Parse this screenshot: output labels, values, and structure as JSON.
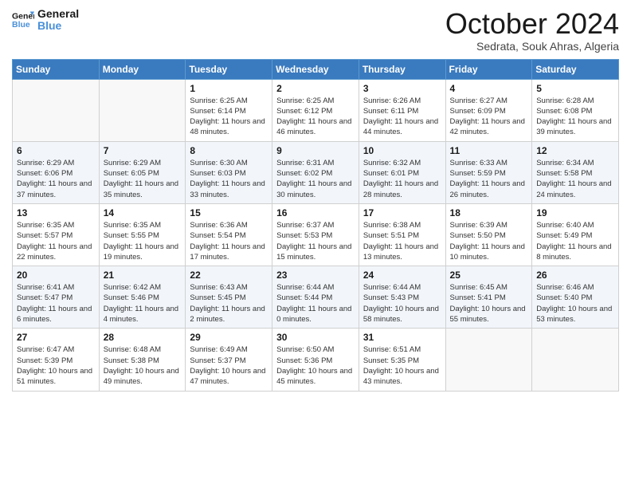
{
  "header": {
    "logo_line1": "General",
    "logo_line2": "Blue",
    "month": "October 2024",
    "location": "Sedrata, Souk Ahras, Algeria"
  },
  "weekdays": [
    "Sunday",
    "Monday",
    "Tuesday",
    "Wednesday",
    "Thursday",
    "Friday",
    "Saturday"
  ],
  "weeks": [
    [
      {
        "day": "",
        "sunrise": "",
        "sunset": "",
        "daylight": ""
      },
      {
        "day": "",
        "sunrise": "",
        "sunset": "",
        "daylight": ""
      },
      {
        "day": "1",
        "sunrise": "Sunrise: 6:25 AM",
        "sunset": "Sunset: 6:14 PM",
        "daylight": "Daylight: 11 hours and 48 minutes."
      },
      {
        "day": "2",
        "sunrise": "Sunrise: 6:25 AM",
        "sunset": "Sunset: 6:12 PM",
        "daylight": "Daylight: 11 hours and 46 minutes."
      },
      {
        "day": "3",
        "sunrise": "Sunrise: 6:26 AM",
        "sunset": "Sunset: 6:11 PM",
        "daylight": "Daylight: 11 hours and 44 minutes."
      },
      {
        "day": "4",
        "sunrise": "Sunrise: 6:27 AM",
        "sunset": "Sunset: 6:09 PM",
        "daylight": "Daylight: 11 hours and 42 minutes."
      },
      {
        "day": "5",
        "sunrise": "Sunrise: 6:28 AM",
        "sunset": "Sunset: 6:08 PM",
        "daylight": "Daylight: 11 hours and 39 minutes."
      }
    ],
    [
      {
        "day": "6",
        "sunrise": "Sunrise: 6:29 AM",
        "sunset": "Sunset: 6:06 PM",
        "daylight": "Daylight: 11 hours and 37 minutes."
      },
      {
        "day": "7",
        "sunrise": "Sunrise: 6:29 AM",
        "sunset": "Sunset: 6:05 PM",
        "daylight": "Daylight: 11 hours and 35 minutes."
      },
      {
        "day": "8",
        "sunrise": "Sunrise: 6:30 AM",
        "sunset": "Sunset: 6:03 PM",
        "daylight": "Daylight: 11 hours and 33 minutes."
      },
      {
        "day": "9",
        "sunrise": "Sunrise: 6:31 AM",
        "sunset": "Sunset: 6:02 PM",
        "daylight": "Daylight: 11 hours and 30 minutes."
      },
      {
        "day": "10",
        "sunrise": "Sunrise: 6:32 AM",
        "sunset": "Sunset: 6:01 PM",
        "daylight": "Daylight: 11 hours and 28 minutes."
      },
      {
        "day": "11",
        "sunrise": "Sunrise: 6:33 AM",
        "sunset": "Sunset: 5:59 PM",
        "daylight": "Daylight: 11 hours and 26 minutes."
      },
      {
        "day": "12",
        "sunrise": "Sunrise: 6:34 AM",
        "sunset": "Sunset: 5:58 PM",
        "daylight": "Daylight: 11 hours and 24 minutes."
      }
    ],
    [
      {
        "day": "13",
        "sunrise": "Sunrise: 6:35 AM",
        "sunset": "Sunset: 5:57 PM",
        "daylight": "Daylight: 11 hours and 22 minutes."
      },
      {
        "day": "14",
        "sunrise": "Sunrise: 6:35 AM",
        "sunset": "Sunset: 5:55 PM",
        "daylight": "Daylight: 11 hours and 19 minutes."
      },
      {
        "day": "15",
        "sunrise": "Sunrise: 6:36 AM",
        "sunset": "Sunset: 5:54 PM",
        "daylight": "Daylight: 11 hours and 17 minutes."
      },
      {
        "day": "16",
        "sunrise": "Sunrise: 6:37 AM",
        "sunset": "Sunset: 5:53 PM",
        "daylight": "Daylight: 11 hours and 15 minutes."
      },
      {
        "day": "17",
        "sunrise": "Sunrise: 6:38 AM",
        "sunset": "Sunset: 5:51 PM",
        "daylight": "Daylight: 11 hours and 13 minutes."
      },
      {
        "day": "18",
        "sunrise": "Sunrise: 6:39 AM",
        "sunset": "Sunset: 5:50 PM",
        "daylight": "Daylight: 11 hours and 10 minutes."
      },
      {
        "day": "19",
        "sunrise": "Sunrise: 6:40 AM",
        "sunset": "Sunset: 5:49 PM",
        "daylight": "Daylight: 11 hours and 8 minutes."
      }
    ],
    [
      {
        "day": "20",
        "sunrise": "Sunrise: 6:41 AM",
        "sunset": "Sunset: 5:47 PM",
        "daylight": "Daylight: 11 hours and 6 minutes."
      },
      {
        "day": "21",
        "sunrise": "Sunrise: 6:42 AM",
        "sunset": "Sunset: 5:46 PM",
        "daylight": "Daylight: 11 hours and 4 minutes."
      },
      {
        "day": "22",
        "sunrise": "Sunrise: 6:43 AM",
        "sunset": "Sunset: 5:45 PM",
        "daylight": "Daylight: 11 hours and 2 minutes."
      },
      {
        "day": "23",
        "sunrise": "Sunrise: 6:44 AM",
        "sunset": "Sunset: 5:44 PM",
        "daylight": "Daylight: 11 hours and 0 minutes."
      },
      {
        "day": "24",
        "sunrise": "Sunrise: 6:44 AM",
        "sunset": "Sunset: 5:43 PM",
        "daylight": "Daylight: 10 hours and 58 minutes."
      },
      {
        "day": "25",
        "sunrise": "Sunrise: 6:45 AM",
        "sunset": "Sunset: 5:41 PM",
        "daylight": "Daylight: 10 hours and 55 minutes."
      },
      {
        "day": "26",
        "sunrise": "Sunrise: 6:46 AM",
        "sunset": "Sunset: 5:40 PM",
        "daylight": "Daylight: 10 hours and 53 minutes."
      }
    ],
    [
      {
        "day": "27",
        "sunrise": "Sunrise: 6:47 AM",
        "sunset": "Sunset: 5:39 PM",
        "daylight": "Daylight: 10 hours and 51 minutes."
      },
      {
        "day": "28",
        "sunrise": "Sunrise: 6:48 AM",
        "sunset": "Sunset: 5:38 PM",
        "daylight": "Daylight: 10 hours and 49 minutes."
      },
      {
        "day": "29",
        "sunrise": "Sunrise: 6:49 AM",
        "sunset": "Sunset: 5:37 PM",
        "daylight": "Daylight: 10 hours and 47 minutes."
      },
      {
        "day": "30",
        "sunrise": "Sunrise: 6:50 AM",
        "sunset": "Sunset: 5:36 PM",
        "daylight": "Daylight: 10 hours and 45 minutes."
      },
      {
        "day": "31",
        "sunrise": "Sunrise: 6:51 AM",
        "sunset": "Sunset: 5:35 PM",
        "daylight": "Daylight: 10 hours and 43 minutes."
      },
      {
        "day": "",
        "sunrise": "",
        "sunset": "",
        "daylight": ""
      },
      {
        "day": "",
        "sunrise": "",
        "sunset": "",
        "daylight": ""
      }
    ]
  ]
}
